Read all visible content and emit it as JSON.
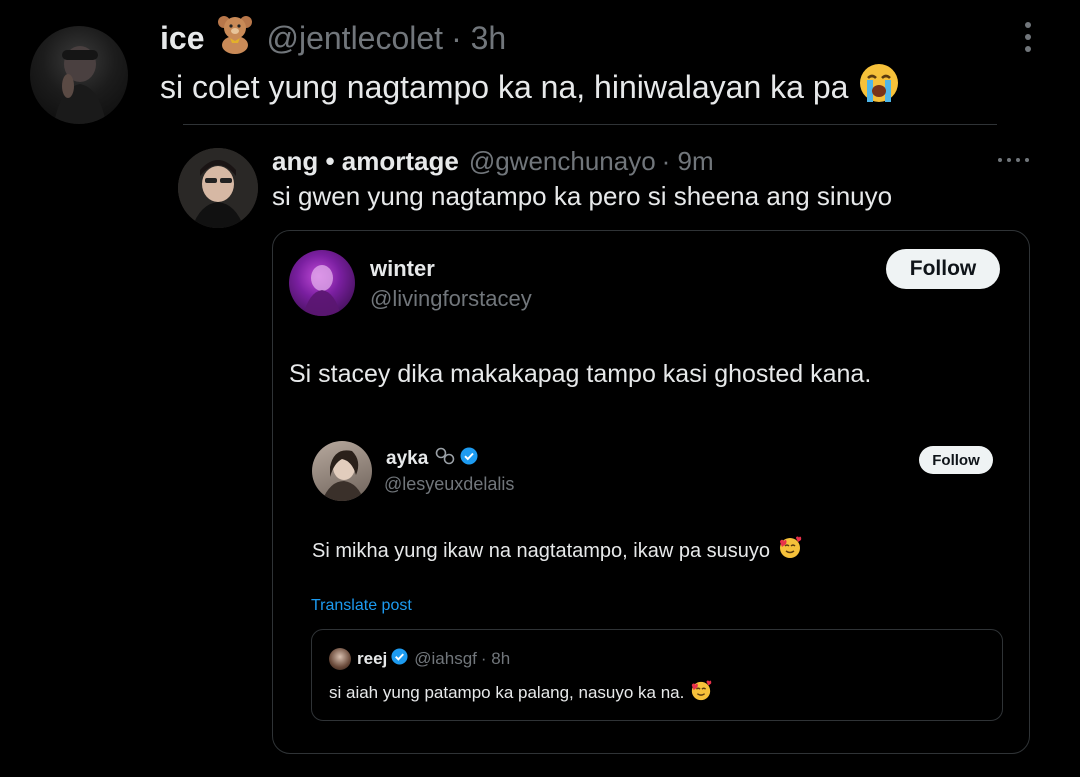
{
  "tweet1": {
    "name": "ice",
    "handle": "@jentlecolet",
    "time": "· 3h",
    "text": "si colet yung nagtampo ka na, hiniwalayan ka pa",
    "name_emoji": "teddy-bear",
    "text_emoji": "loudly-crying-face"
  },
  "tweet2": {
    "name": "ang • amortage",
    "handle": "@gwenchunayo",
    "time": "· 9m",
    "text": "si gwen yung nagtampo ka pero si sheena ang sinuyo"
  },
  "quote1": {
    "name": "winter",
    "handle": "@livingforstacey",
    "follow_label": "Follow",
    "text": "Si stacey dika makakapag tampo kasi ghosted kana."
  },
  "quote2": {
    "name": "ayka",
    "handle": "@lesyeuxdelalis",
    "follow_label": "Follow",
    "text": "Si mikha yung ikaw na nagtatampo, ikaw pa susuyo",
    "text_emoji": "smiling-face-with-hearts",
    "translate_label": "Translate post"
  },
  "quote3": {
    "name": "reej",
    "handle": "@iahsgf",
    "time": "· 8h",
    "text": "si aiah yung patampo ka palang, nasuyo ka na.",
    "text_emoji": "smiling-face-with-hearts"
  },
  "colors": {
    "background": "#000000",
    "text": "#e7e9ea",
    "muted": "#71767b",
    "border": "#2f3336",
    "verified": "#1d9bf0",
    "link": "#1d9bf0"
  }
}
